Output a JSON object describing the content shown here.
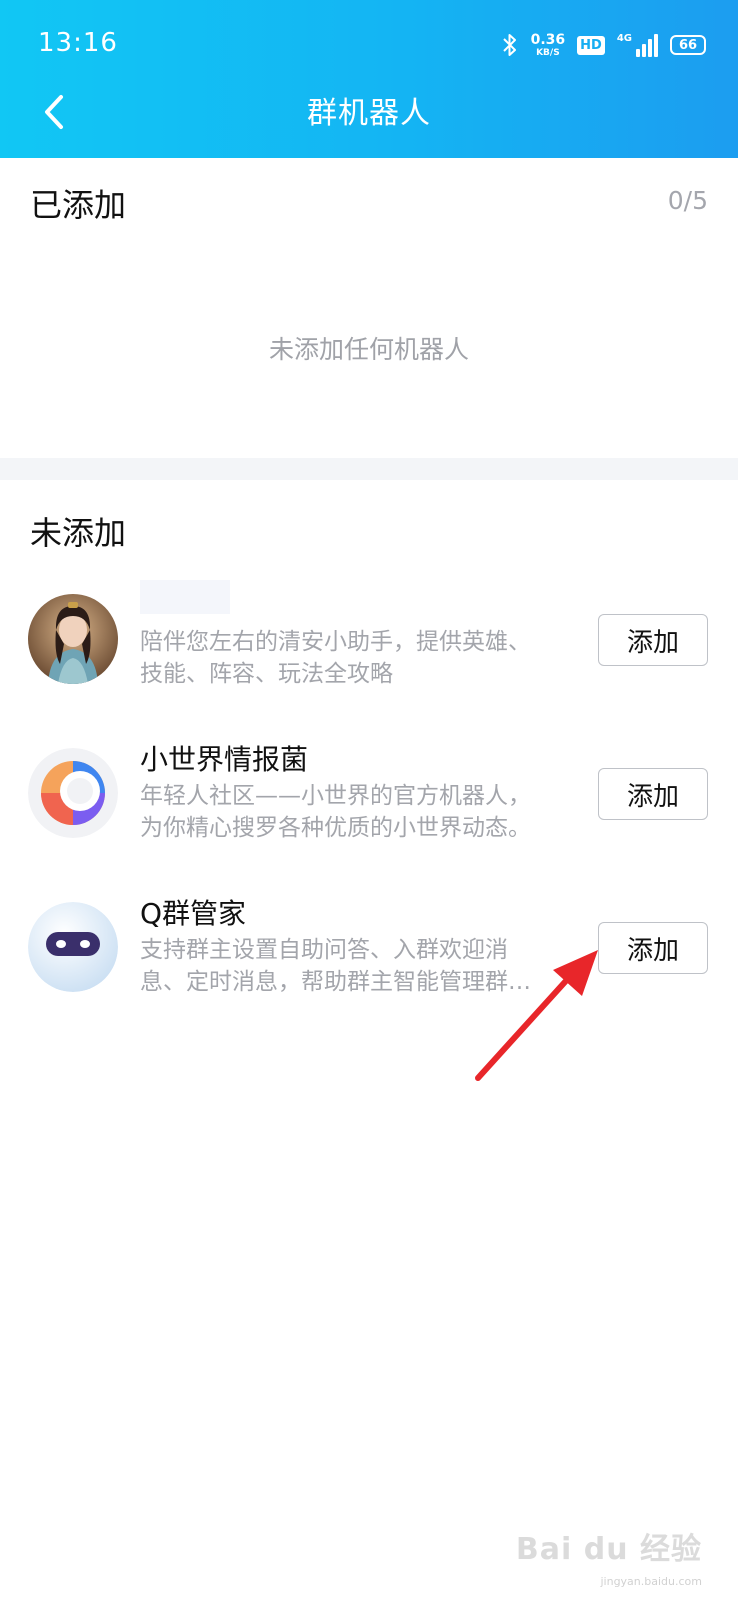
{
  "status_bar": {
    "time": "13:16",
    "net_speed_value": "0.36",
    "net_speed_unit": "KB/S",
    "hd_label": "HD",
    "network_label": "4G",
    "battery": "66",
    "icons": [
      "bluetooth-icon",
      "hd-icon",
      "signal-icon",
      "battery-icon"
    ]
  },
  "nav": {
    "back_icon": "chevron-left-icon",
    "title": "群机器人"
  },
  "added_section": {
    "title": "已添加",
    "count": "0/5",
    "empty_text": "未添加任何机器人"
  },
  "not_added_section": {
    "title": "未添加",
    "bots": [
      {
        "name": "",
        "desc_lines": [
          "陪伴您左右的清安小助手，提供英雄、",
          "技能、阵容、玩法全攻略"
        ],
        "button_label": "添加"
      },
      {
        "name": "小世界情报菌",
        "desc_lines": [
          "年轻人社区——小世界的官方机器人，",
          "为你精心搜罗各种优质的小世界动态。"
        ],
        "button_label": "添加"
      },
      {
        "name": "Q群管家",
        "desc_lines": [
          "支持群主设置自助问答、入群欢迎消",
          "息、定时消息，帮助群主智能管理群…"
        ],
        "button_label": "添加"
      }
    ]
  },
  "colors": {
    "header_gradient_start": "#11c7f4",
    "header_gradient_end": "#1c9df0",
    "annotation_arrow": "#e8262a"
  },
  "watermark": {
    "text": "Bai du 经验",
    "url": "jingyan.baidu.com"
  }
}
